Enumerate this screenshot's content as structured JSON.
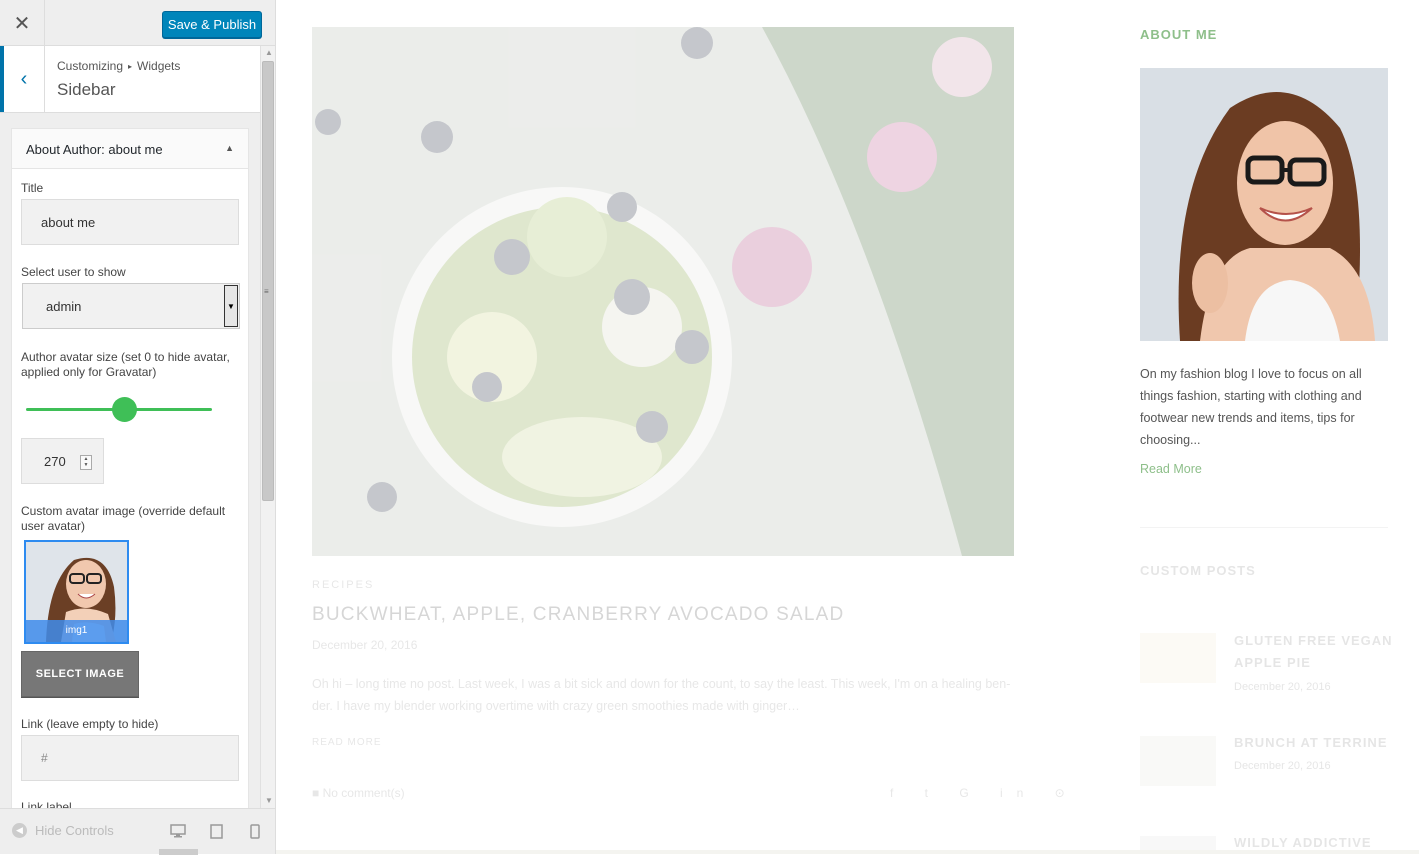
{
  "header": {
    "close_icon": "close-icon",
    "publish_label": "Save & Publish"
  },
  "section": {
    "breadcrumb_root": "Customizing",
    "breadcrumb_child": "Widgets",
    "title": "Sidebar"
  },
  "widget": {
    "name": "About Author:",
    "instance": "about me",
    "fields": {
      "title_label": "Title",
      "title_value": "about me",
      "user_label": "Select user to show",
      "user_value": "admin",
      "avatar_size_label": "Author avatar size (set 0 to hide avatar, applied only for Gravatar)",
      "avatar_size_value": "270",
      "avatar_size_slider_fraction": 0.53,
      "custom_avatar_label": "Custom avatar image (override default user avatar)",
      "custom_avatar_caption": "img1",
      "select_image_label": "SELECT IMAGE",
      "link_label": "Link (leave empty to hide)",
      "link_value": "#",
      "link_label_label": "Link label"
    }
  },
  "footer": {
    "hide_controls": "Hide Controls"
  },
  "preview": {
    "post": {
      "category": "RECIPES",
      "title": "BUCKWHEAT, APPLE, CRANBERRY AVOCADO SALAD",
      "date": "December 20, 2016",
      "excerpt": "Oh hi – long time no post. Last week, I was a bit sick and down for the count, to say the least. This week, I'm on a healing ben-der. I have my blender working overtime with crazy green smoothies made with ginger…",
      "read_more": "READ MORE",
      "comments": "No comment(s)"
    },
    "sidebar": {
      "about_title": "ABOUT ME",
      "about_text": "On my fashion blog I love to focus on all things fashion, starting with clothing and footwear new trends and items, tips for choosing...",
      "read_more": "Read More",
      "custom_posts_title": "CUSTOM POSTS",
      "custom_posts": [
        {
          "title": "GLUTEN FREE VEGAN APPLE PIE",
          "date": "December 20, 2016"
        },
        {
          "title": "BRUNCH AT TERRINE",
          "date": "December 20, 2016"
        },
        {
          "title": "WILDLY ADDICTIVE",
          "date": ""
        }
      ]
    },
    "colors": {
      "accent_green": "#8ebf8a",
      "publish_blue": "#0085ba",
      "slider_green": "#3fbf57"
    }
  }
}
